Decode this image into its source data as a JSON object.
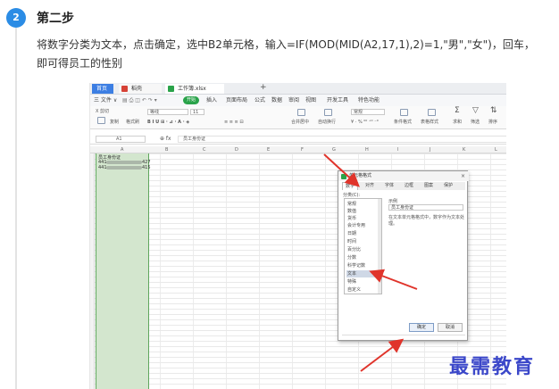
{
  "step": {
    "number": "2",
    "title": "第二步"
  },
  "instructions": {
    "line1": "将数字分类为文本，点击确定，选中B2单元格，输入=IF(MOD(MID(A2,17,1),2)=1,\"男\",\"女\")，回车，",
    "line2": "即可得员工的性别"
  },
  "screenshot": {
    "tabs": {
      "home": "首页",
      "doc": "稻壳",
      "file": "工作簿.xlsx",
      "new": "+"
    },
    "menu": {
      "file": "三 文件 ∨",
      "items": [
        "插入",
        "页面布局",
        "公式",
        "数据",
        "审阅",
        "视图",
        "开发工具",
        "特色功能"
      ],
      "start": "开始"
    },
    "ribbon": {
      "cut": "X 剪切",
      "paste": "粘贴",
      "format_painter": "格式刷",
      "copy": "复制",
      "font": "等线",
      "font_size": "11",
      "merge": "合并居中",
      "wrap": "自动换行",
      "number_format": "常规",
      "cond_format": "条件格式",
      "table_style": "表格样式",
      "sum": "求和",
      "filter": "筛选",
      "sort": "排序"
    },
    "formula_bar": {
      "name_box": "A1",
      "fx": "⊕ fx",
      "content": "员工身份证"
    },
    "columns": [
      "A",
      "B",
      "C",
      "D",
      "E",
      "F",
      "G",
      "H",
      "I",
      "J",
      "K",
      "L"
    ],
    "cells": {
      "a1": "员工身份证",
      "a2_prefix": "441",
      "a2_suffix": "427",
      "a3_prefix": "441",
      "a3_suffix": "415"
    },
    "dialog": {
      "title": "单元格格式",
      "close": "×",
      "tabs": [
        "数字",
        "对齐",
        "字体",
        "边框",
        "图案",
        "保护"
      ],
      "category_label": "分类(C):",
      "categories": [
        "常规",
        "数值",
        "货币",
        "会计专用",
        "日期",
        "时间",
        "百分比",
        "分数",
        "科学记数",
        "文本",
        "特殊",
        "自定义"
      ],
      "selected": "文本",
      "sample_label": "示例",
      "sample_value": "员工身份证",
      "description": "在文本单元格格式中，数字作为文本处理。",
      "ok": "确定",
      "cancel": "取消"
    }
  },
  "watermark": "最需教育",
  "colors": {
    "badge": "#2b8ce5",
    "arrow": "#e0342b",
    "selection": "#d3e6ce",
    "watermark": "#3b47c9"
  }
}
